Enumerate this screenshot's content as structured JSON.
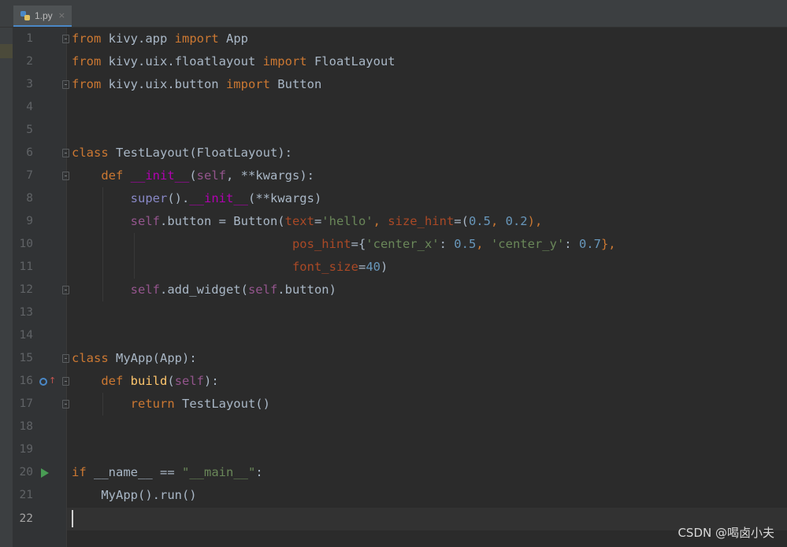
{
  "tab": {
    "filename": "1.py",
    "close_glyph": "×"
  },
  "lines": [
    {
      "n": "1"
    },
    {
      "n": "2"
    },
    {
      "n": "3"
    },
    {
      "n": "4"
    },
    {
      "n": "5"
    },
    {
      "n": "6"
    },
    {
      "n": "7"
    },
    {
      "n": "8"
    },
    {
      "n": "9"
    },
    {
      "n": "10"
    },
    {
      "n": "11"
    },
    {
      "n": "12"
    },
    {
      "n": "13"
    },
    {
      "n": "14"
    },
    {
      "n": "15"
    },
    {
      "n": "16"
    },
    {
      "n": "17"
    },
    {
      "n": "18"
    },
    {
      "n": "19"
    },
    {
      "n": "20"
    },
    {
      "n": "21"
    },
    {
      "n": "22"
    }
  ],
  "code": {
    "l1": [
      "from",
      " kivy.app ",
      "import",
      " App"
    ],
    "l2": [
      "from",
      " kivy.uix.floatlayout ",
      "import",
      " FloatLayout"
    ],
    "l3": [
      "from",
      " kivy.uix.button ",
      "import",
      " Button"
    ],
    "l6": [
      "class",
      " TestLayout(FloatLayout):"
    ],
    "l7": [
      "    ",
      "def",
      " ",
      "__init__",
      "(",
      "self",
      ", **kwargs):"
    ],
    "l8": [
      "        ",
      "super",
      "().",
      "__init__",
      "(**kwargs)"
    ],
    "l9": [
      "        ",
      "self",
      ".button = Button(",
      "text",
      "=",
      "'hello'",
      ", ",
      "size_hint",
      "=(",
      "0.5",
      ", ",
      "0.2",
      "),"
    ],
    "l10": [
      "                              ",
      "pos_hint",
      "={",
      "'center_x'",
      ": ",
      "0.5",
      ", ",
      "'center_y'",
      ": ",
      "0.7",
      "},"
    ],
    "l11": [
      "                              ",
      "font_size",
      "=",
      "40",
      ")"
    ],
    "l12": [
      "        ",
      "self",
      ".add_widget(",
      "self",
      ".button)"
    ],
    "l15": [
      "class",
      " MyApp(App):"
    ],
    "l16": [
      "    ",
      "def",
      " ",
      "build",
      "(",
      "self",
      "):"
    ],
    "l17": [
      "        ",
      "return",
      " TestLayout()"
    ],
    "l20": [
      "if",
      " __name__ == ",
      "\"__main__\"",
      ":"
    ],
    "l21": [
      "    MyApp().run()"
    ]
  },
  "watermark": "CSDN @喝卤小夫",
  "colors": {
    "background": "#2b2b2b",
    "keyword": "#cc7832",
    "self": "#94558d",
    "parameter": "#aa4926",
    "string": "#6a8759",
    "number": "#6897bb",
    "dunder": "#b200b2",
    "function": "#ffc66d"
  },
  "icons": {
    "run": "run-icon",
    "override": "override-icon",
    "fold": "fold-icon",
    "file": "python-file-icon"
  }
}
